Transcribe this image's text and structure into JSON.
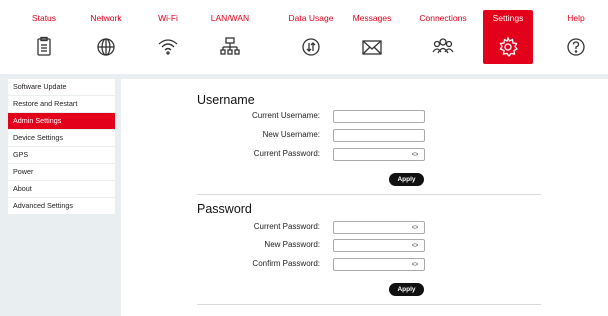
{
  "nav": {
    "tabs": [
      {
        "label": "Status",
        "icon": "status-icon",
        "active": false
      },
      {
        "label": "Network",
        "icon": "globe-icon",
        "active": false
      },
      {
        "label": "Wi-Fi",
        "icon": "wifi-icon",
        "active": false
      },
      {
        "label": "LAN/WAN",
        "icon": "lan-icon",
        "active": false
      },
      {
        "label": "Data Usage",
        "icon": "data-usage-icon",
        "active": false
      },
      {
        "label": "Messages",
        "icon": "envelope-icon",
        "active": false
      },
      {
        "label": "Connections",
        "icon": "users-icon",
        "active": false
      },
      {
        "label": "Settings",
        "icon": "gear-icon",
        "active": true
      },
      {
        "label": "Help",
        "icon": "help-icon",
        "active": false
      }
    ]
  },
  "sidebar": {
    "items": [
      {
        "label": "Software Update",
        "active": false
      },
      {
        "label": "Restore and Restart",
        "active": false
      },
      {
        "label": "Admin Settings",
        "active": true
      },
      {
        "label": "Device Settings",
        "active": false
      },
      {
        "label": "GPS",
        "active": false
      },
      {
        "label": "Power",
        "active": false
      },
      {
        "label": "About",
        "active": false
      },
      {
        "label": "Advanced Settings",
        "active": false
      }
    ]
  },
  "username": {
    "title": "Username",
    "current_username_label": "Current Username:",
    "current_username_value": "",
    "new_username_label": "New Username:",
    "new_username_value": "",
    "current_password_label": "Current Password:",
    "current_password_value": "",
    "apply_label": "Apply"
  },
  "password": {
    "title": "Password",
    "current_password_label": "Current Password:",
    "current_password_value": "",
    "new_password_label": "New Password:",
    "new_password_value": "",
    "confirm_password_label": "Confirm Password:",
    "confirm_password_value": "",
    "apply_label": "Apply"
  },
  "colors": {
    "accent": "#e3001b",
    "background": "#e9eef1"
  }
}
